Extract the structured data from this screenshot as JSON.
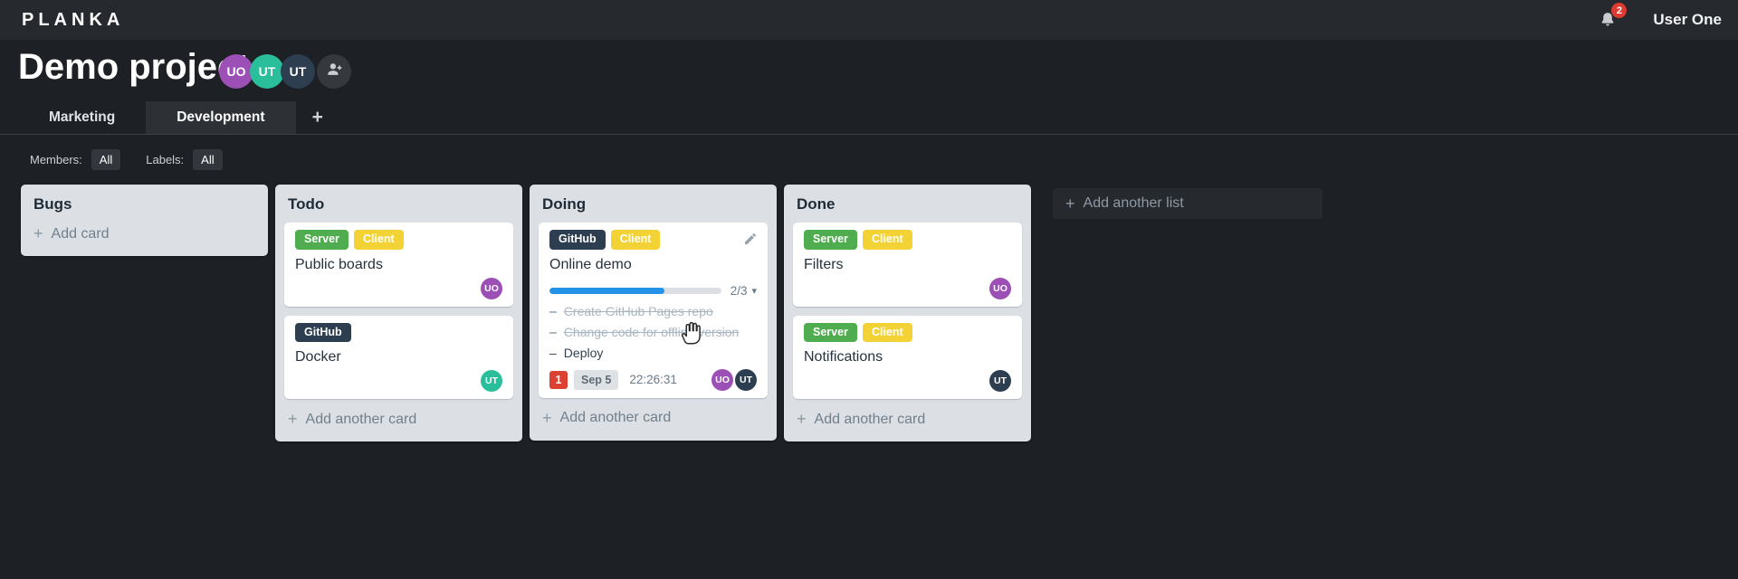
{
  "icons": {
    "plus": "+",
    "caret_down": "▾",
    "task_marker": "–"
  },
  "topbar": {
    "logo": "PLANKA",
    "user": "User One",
    "notification_count": "2"
  },
  "project": {
    "title": "Demo project",
    "members": [
      {
        "initials": "UO",
        "color": "#9c4fb5"
      },
      {
        "initials": "UT",
        "color": "#2abf9a"
      },
      {
        "initials": "UT",
        "color": "#2d3e50"
      }
    ]
  },
  "tabs": [
    {
      "label": "Marketing",
      "active": false
    },
    {
      "label": "Development",
      "active": true
    }
  ],
  "filters": {
    "members_label": "Members:",
    "members_value": "All",
    "labels_label": "Labels:",
    "labels_value": "All"
  },
  "board": {
    "add_list_label": "Add another list",
    "lists": [
      {
        "title": "Bugs",
        "add_label": "Add card",
        "cards": []
      },
      {
        "title": "Todo",
        "add_label": "Add another card",
        "cards": [
          {
            "labels": [
              {
                "text": "Server",
                "color": "#4fad4f"
              },
              {
                "text": "Client",
                "color": "#f2d235"
              }
            ],
            "title": "Public boards",
            "avatar": {
              "initials": "UO",
              "color": "#9c4fb5"
            }
          },
          {
            "labels": [
              {
                "text": "GitHub",
                "color": "#2d3e50"
              }
            ],
            "title": "Docker",
            "avatar": {
              "initials": "UT",
              "color": "#2abf9a"
            }
          }
        ]
      },
      {
        "title": "Doing",
        "add_label": "Add another card",
        "cards": [
          {
            "labels": [
              {
                "text": "GitHub",
                "color": "#2d3e50"
              },
              {
                "text": "Client",
                "color": "#f2d235"
              }
            ],
            "title": "Online demo",
            "editable": true,
            "progress": {
              "label": "2/3",
              "percent": 67,
              "color": "#2492e7"
            },
            "tasks": [
              {
                "text": "Create GitHub Pages repo",
                "done": true
              },
              {
                "text": "Change code for offline version",
                "done": true
              },
              {
                "text": "Deploy",
                "done": false
              }
            ],
            "badges": {
              "notification_count": "1",
              "due_date": "Sep 5",
              "timer": "22:26:31"
            },
            "avatars": [
              {
                "initials": "UO",
                "color": "#9c4fb5"
              },
              {
                "initials": "UT",
                "color": "#2d3e50"
              }
            ]
          }
        ]
      },
      {
        "title": "Done",
        "add_label": "Add another card",
        "cards": [
          {
            "labels": [
              {
                "text": "Server",
                "color": "#4fad4f"
              },
              {
                "text": "Client",
                "color": "#f2d235"
              }
            ],
            "title": "Filters",
            "avatar": {
              "initials": "UO",
              "color": "#9c4fb5"
            }
          },
          {
            "labels": [
              {
                "text": "Server",
                "color": "#4fad4f"
              },
              {
                "text": "Client",
                "color": "#f2d235"
              }
            ],
            "title": "Notifications",
            "avatar": {
              "initials": "UT",
              "color": "#2d3e50"
            }
          }
        ]
      }
    ]
  }
}
